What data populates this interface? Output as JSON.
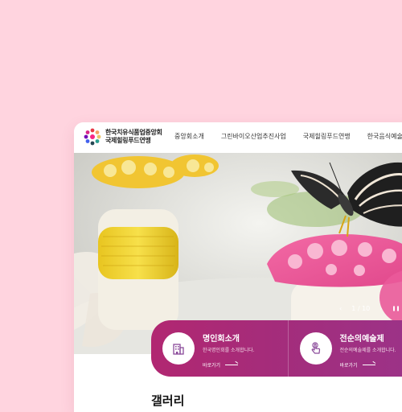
{
  "header": {
    "org_name_line1": "한국치유식품업중앙회",
    "org_name_line2": "국제힐링푸드연맹"
  },
  "nav": {
    "items": [
      "중앙회소개",
      "그린바이오산업추진사업",
      "국제힐링푸드연맹",
      "한국음식예술"
    ]
  },
  "hero": {
    "slide_counter": "1 / 10",
    "prev_label": "‹",
    "next_label": "›",
    "pause_label": "❚❚"
  },
  "quick_links": [
    {
      "title": "명인회소개",
      "desc": "한국명인회를 소개합니다.",
      "link": "바로가기",
      "icon": "building-icon"
    },
    {
      "title": "전순의예술제",
      "desc": "전순의예술제를 소개합니다.",
      "link": "바로가기",
      "icon": "hand-pointer-icon"
    }
  ],
  "gallery": {
    "title": "갤러리"
  },
  "colors": {
    "page_bg": "#ffd4df",
    "accent_start": "#b12771",
    "accent_end": "#9b3389"
  }
}
